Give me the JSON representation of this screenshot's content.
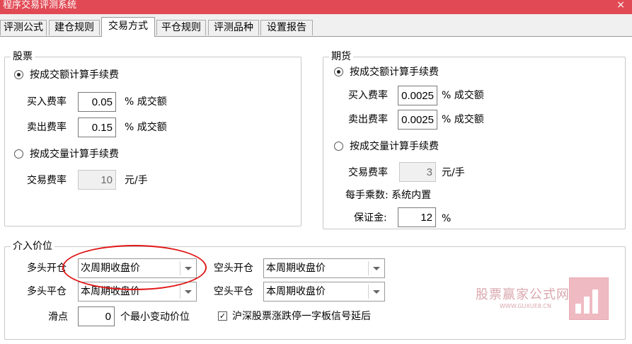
{
  "window": {
    "title": "程序交易评测系统",
    "close_glyph": "×"
  },
  "tabs": [
    {
      "label": "评测公式"
    },
    {
      "label": "建仓规则"
    },
    {
      "label": "交易方式"
    },
    {
      "label": "平仓规则"
    },
    {
      "label": "评测品种"
    },
    {
      "label": "设置报告"
    }
  ],
  "stock": {
    "title": "股票",
    "by_amount_label": "按成交额计算手续费",
    "buy_label": "买入费率",
    "buy_value": "0.05",
    "buy_unit": "% 成交额",
    "sell_label": "卖出费率",
    "sell_value": "0.15",
    "sell_unit": "% 成交额",
    "by_volume_label": "按成交量计算手续费",
    "trade_label": "交易费率",
    "trade_value": "10",
    "trade_unit": "元/手"
  },
  "futures": {
    "title": "期货",
    "by_amount_label": "按成交额计算手续费",
    "buy_label": "买入费率",
    "buy_value": "0.0025",
    "buy_unit": "% 成交额",
    "sell_label": "卖出费率",
    "sell_value": "0.0025",
    "sell_unit": "% 成交额",
    "by_volume_label": "按成交量计算手续费",
    "trade_label": "交易费率",
    "trade_value": "3",
    "trade_unit": "元/手",
    "multiplier_label": "每手乘数: 系统内置",
    "margin_label": "保证金:",
    "margin_value": "12",
    "margin_unit": "%"
  },
  "entry": {
    "title": "介入价位",
    "long_open_label": "多头开仓",
    "long_open_value": "次周期收盘价",
    "long_close_label": "多头平仓",
    "long_close_value": "本周期收盘价",
    "short_open_label": "空头开仓",
    "short_open_value": "本周期收盘价",
    "short_close_label": "空头平仓",
    "short_close_value": "本周期收盘价",
    "slippage_label": "滑点",
    "slippage_value": "0",
    "slippage_unit": "个最小变动价位",
    "limit_delay_label": "沪深股票涨跌停一字板信号延后",
    "check_glyph": "✓"
  },
  "watermark": {
    "title": "股票赢家公式网",
    "url": "WWW.GUXUE8.CN"
  },
  "colors": {
    "titlebar": "#e14a55",
    "annotation": "#e01818"
  }
}
